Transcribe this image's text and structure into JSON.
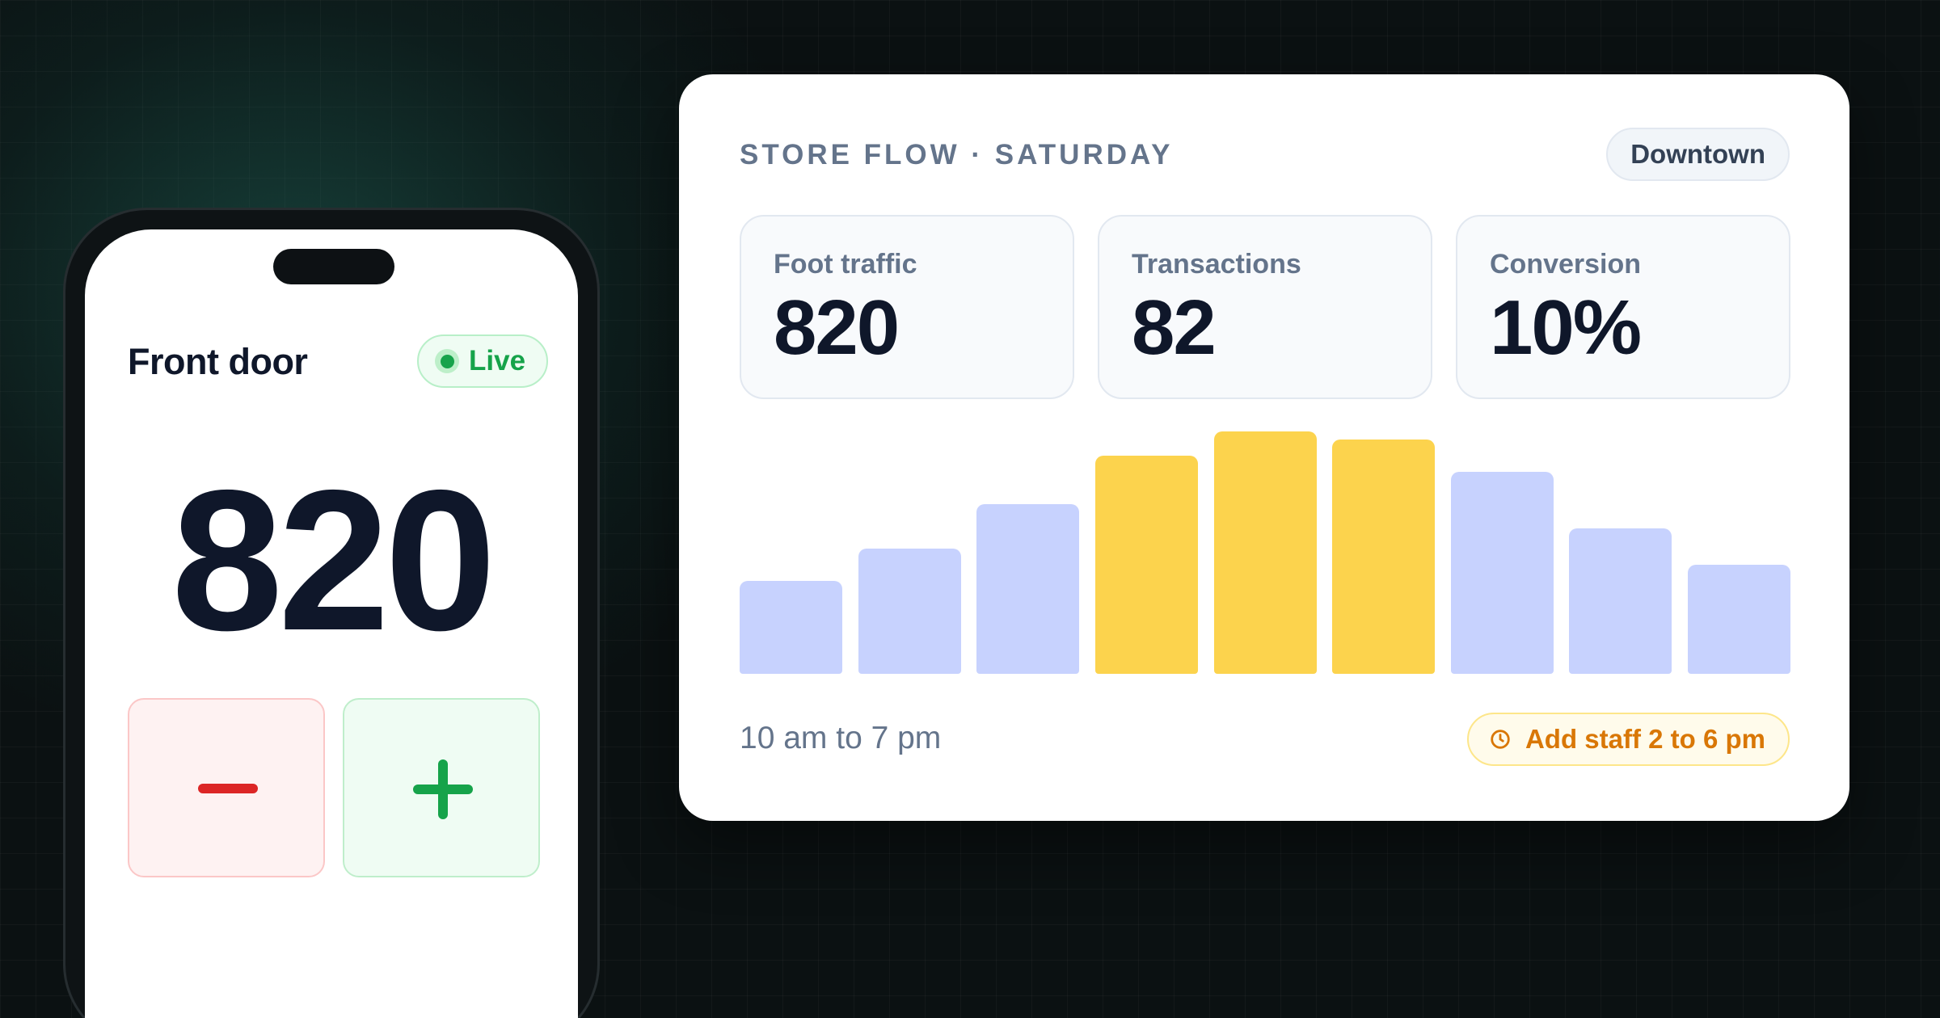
{
  "phone": {
    "title": "Front door",
    "live_label": "Live",
    "count": "820",
    "icons": {
      "decrement": "minus-icon",
      "increment": "plus-icon",
      "live": "live-dot-icon"
    },
    "colors": {
      "live": "#16a34a",
      "decrement": "#dc2626",
      "increment": "#16a34a"
    }
  },
  "dashboard": {
    "title": "STORE FLOW · SATURDAY",
    "location": "Downtown",
    "stats": [
      {
        "label": "Foot traffic",
        "value": "820"
      },
      {
        "label": "Transactions",
        "value": "82"
      },
      {
        "label": "Conversion",
        "value": "10%"
      }
    ],
    "time_range": "10 am to 7 pm",
    "staff_alert": {
      "label": "Add staff 2 to 6 pm",
      "icon": "clock-icon"
    }
  },
  "chart_data": {
    "type": "bar",
    "values": [
      23,
      31,
      42,
      54,
      60,
      58,
      50,
      36,
      27
    ],
    "highlighted": [
      false,
      false,
      false,
      true,
      true,
      true,
      false,
      false,
      false
    ],
    "ylim": [
      0,
      60
    ],
    "colors": {
      "normal": "#c7d2fe",
      "highlight": "#fcd34d"
    }
  }
}
